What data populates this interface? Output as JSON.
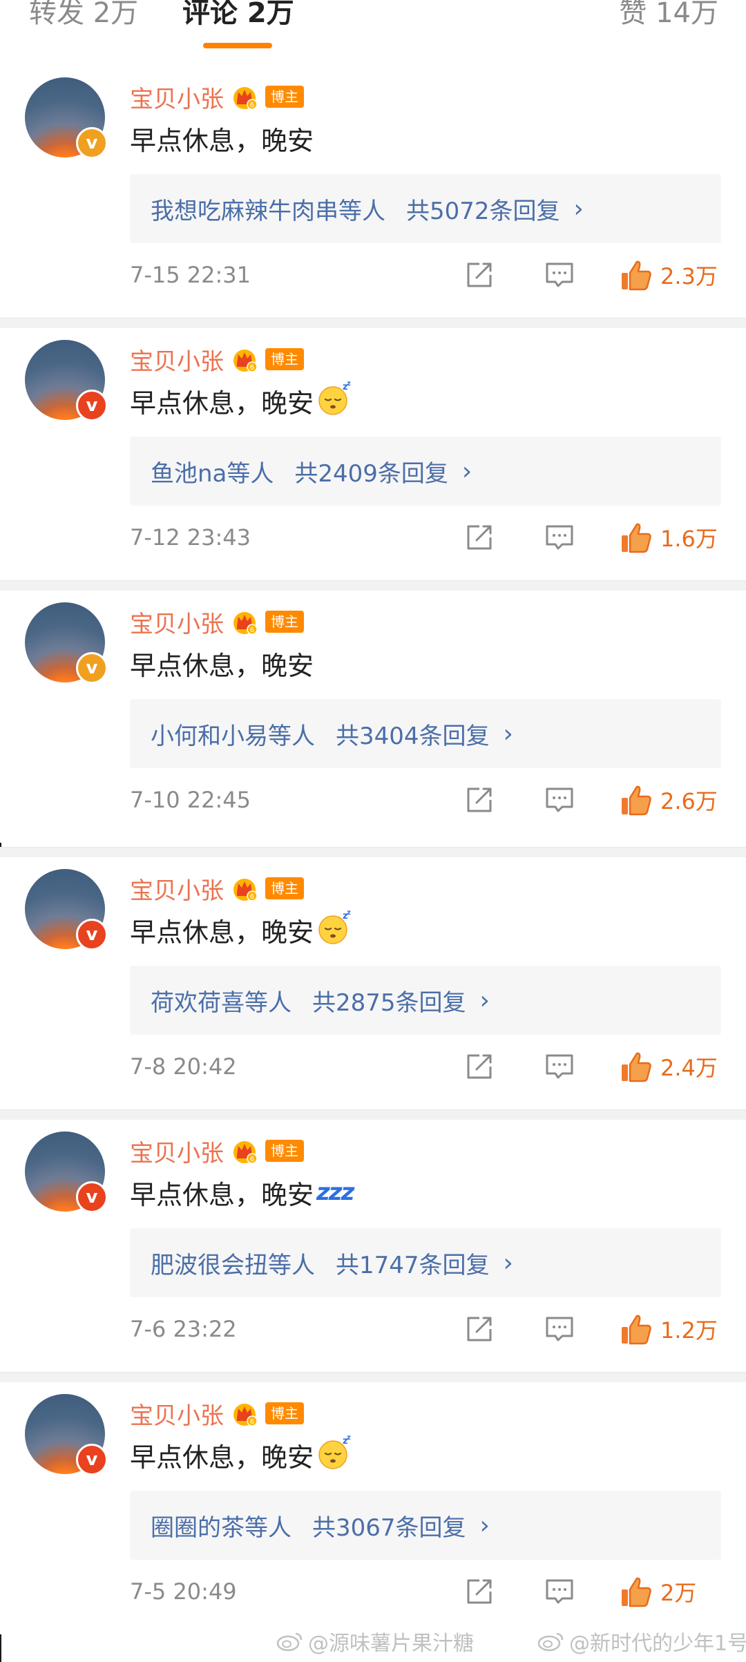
{
  "tabs": {
    "reposts": "转发 2万",
    "comments": "评论 2万",
    "likes": "赞 14万"
  },
  "colors": {
    "accent": "#ff8200",
    "username": "#eb7350",
    "link": "#4b6ea8",
    "like": "#e86b1c"
  },
  "comments": [
    {
      "username": "宝贝小张",
      "badge": "博主",
      "text": "早点休息，晚安",
      "emoji": "",
      "reply_who": "我想吃麻辣牛肉串等人",
      "reply_count": "共5072条回复",
      "time": "7-15 22:31",
      "likes": "2.3万"
    },
    {
      "username": "宝贝小张",
      "badge": "博主",
      "text": "早点休息，晚安",
      "emoji": "sleeping-face",
      "reply_who": "鱼池na等人",
      "reply_count": "共2409条回复",
      "time": "7-12 23:43",
      "likes": "1.6万"
    },
    {
      "username": "宝贝小张",
      "badge": "博主",
      "text": "早点休息，晚安",
      "emoji": "",
      "reply_who": "小何和小易等人",
      "reply_count": "共3404条回复",
      "time": "7-10 22:45",
      "likes": "2.6万"
    },
    {
      "username": "宝贝小张",
      "badge": "博主",
      "text": "早点休息，晚安",
      "emoji": "sleeping-face",
      "reply_who": "荷欢荷喜等人",
      "reply_count": "共2875条回复",
      "time": "7-8 20:42",
      "likes": "2.4万"
    },
    {
      "username": "宝贝小张",
      "badge": "博主",
      "text": "早点休息，晚安",
      "emoji": "zzz",
      "reply_who": "肥波很会扭等人",
      "reply_count": "共1747条回复",
      "time": "7-6 23:22",
      "likes": "1.2万"
    },
    {
      "username": "宝贝小张",
      "badge": "博主",
      "text": "早点休息，晚安",
      "emoji": "sleeping-face",
      "reply_who": "圈圈的茶等人",
      "reply_count": "共3067条回复",
      "time": "7-5 20:49",
      "likes": "2万"
    }
  ],
  "watermarks": [
    "@源味薯片果汁糖",
    "@新时代的少年1号"
  ]
}
